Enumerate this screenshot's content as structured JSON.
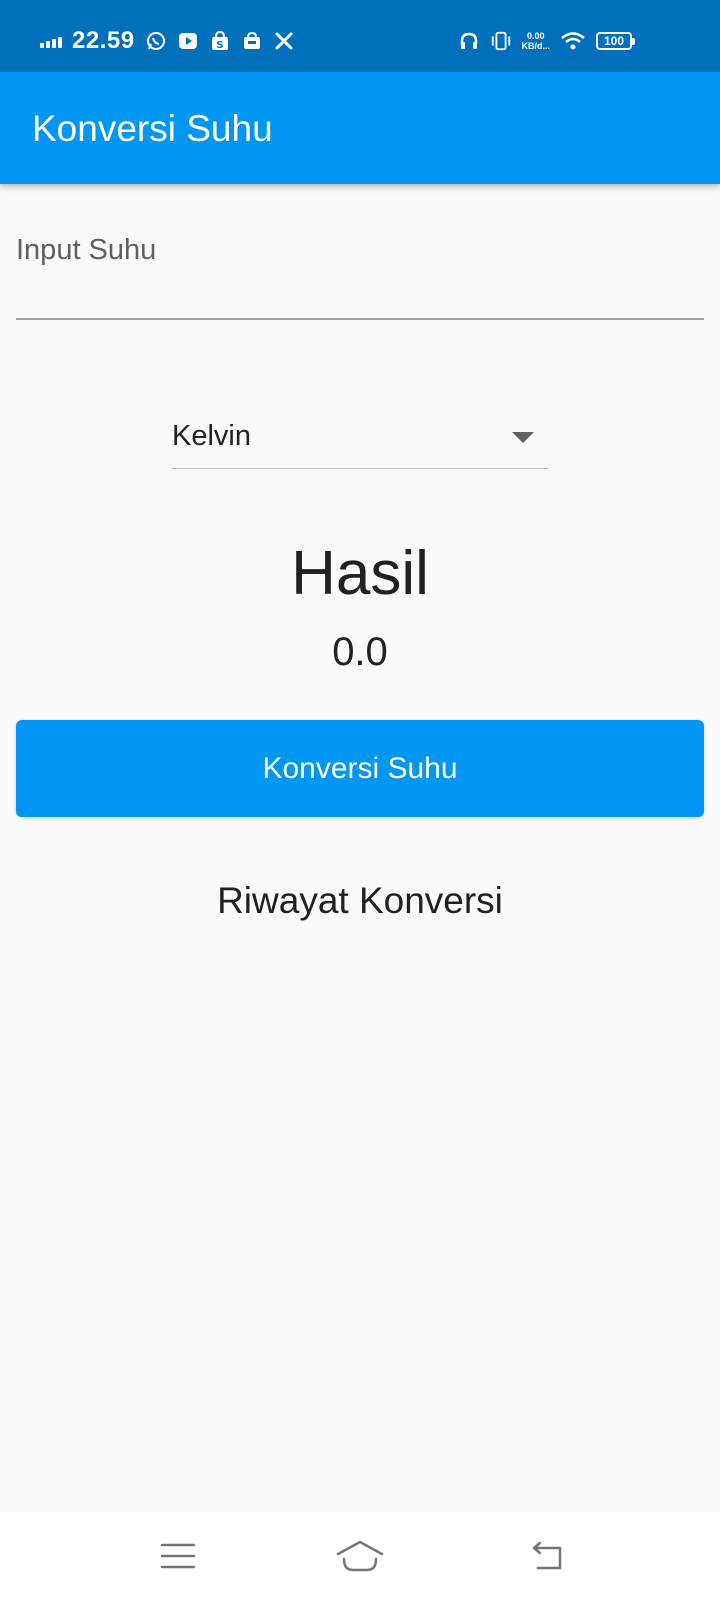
{
  "status_bar": {
    "time": "22.59",
    "net_speed_value": "0.00",
    "net_speed_unit": "KB/d...",
    "battery": "100",
    "icons": [
      "signal-icon",
      "whatsapp-icon",
      "youtube-icon",
      "shopee-icon",
      "shop-icon",
      "tools-icon",
      "headphones-icon",
      "vibrate-icon",
      "wifi-icon",
      "battery-icon"
    ]
  },
  "app_bar": {
    "title": "Konversi Suhu"
  },
  "form": {
    "input_label": "Input Suhu",
    "input_value": "",
    "unit_selected": "Kelvin"
  },
  "result": {
    "heading": "Hasil",
    "value": "0.0"
  },
  "actions": {
    "convert_label": "Konversi Suhu"
  },
  "history": {
    "heading": "Riwayat Konversi"
  },
  "nav_bar": {
    "icons": [
      "menu-icon",
      "home-icon",
      "back-icon"
    ]
  },
  "colors": {
    "status_bar": "#0070BD",
    "primary": "#0096F3",
    "background": "#FAFAFA",
    "text": "#212121"
  }
}
